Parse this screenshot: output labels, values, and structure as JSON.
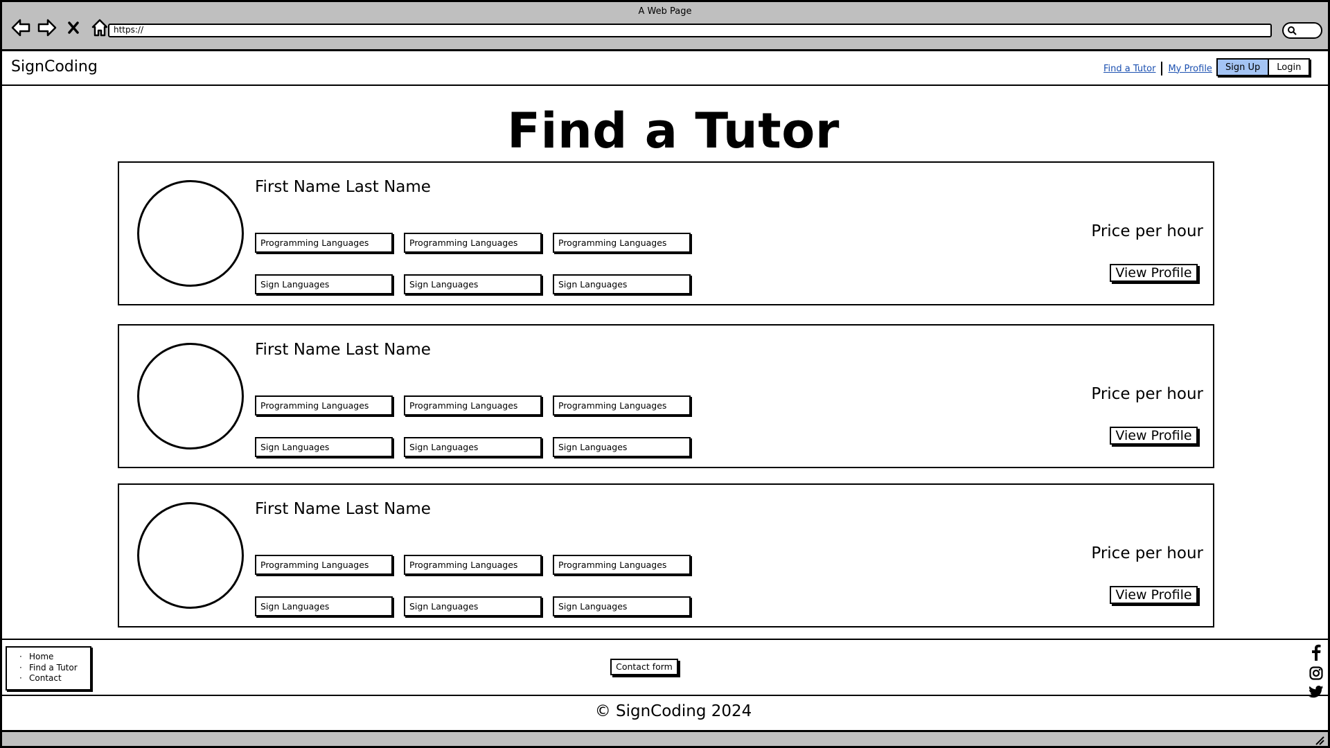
{
  "browser": {
    "title": "A Web Page",
    "url": "https://"
  },
  "header": {
    "brand": "SignCoding",
    "nav": [
      {
        "label": "Find a Tutor"
      },
      {
        "label": "My Profile"
      }
    ],
    "signup_label": "Sign Up",
    "login_label": "Login"
  },
  "main": {
    "title": "Find a Tutor",
    "tutors": [
      {
        "name": "First Name Last Name",
        "programming": [
          "Programming Languages",
          "Programming Languages",
          "Programming Languages"
        ],
        "sign": [
          "Sign Languages",
          "Sign Languages",
          "Sign Languages"
        ],
        "price": "Price per hour",
        "button": "View Profile"
      },
      {
        "name": "First Name Last Name",
        "programming": [
          "Programming Languages",
          "Programming Languages",
          "Programming Languages"
        ],
        "sign": [
          "Sign Languages",
          "Sign Languages",
          "Sign Languages"
        ],
        "price": "Price per hour",
        "button": "View Profile"
      },
      {
        "name": "First Name Last Name",
        "programming": [
          "Programming Languages",
          "Programming Languages",
          "Programming Languages"
        ],
        "sign": [
          "Sign Languages",
          "Sign Languages",
          "Sign Languages"
        ],
        "price": "Price per hour",
        "button": "View Profile"
      }
    ]
  },
  "footer": {
    "links": [
      "Home",
      "Find a Tutor",
      "Contact"
    ],
    "contact_button": "Contact form",
    "social_icons": [
      "facebook-icon",
      "instagram-icon",
      "twitter-icon"
    ],
    "copyright": "© SignCoding 2024"
  },
  "colors": {
    "chrome": "#bfbfbf",
    "link": "#1a4fb0",
    "signup_bg": "#a4c4f4"
  }
}
